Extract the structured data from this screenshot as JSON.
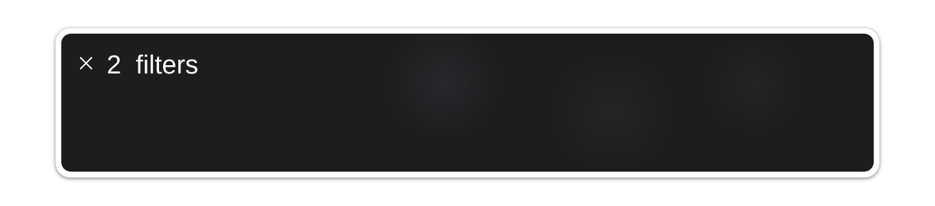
{
  "filter_bar": {
    "close_icon": "close-icon",
    "count": "2",
    "label": "filters"
  },
  "colors": {
    "panel_background": "#1d1d1f",
    "text": "#ffffff",
    "frame": "#ffffff"
  }
}
